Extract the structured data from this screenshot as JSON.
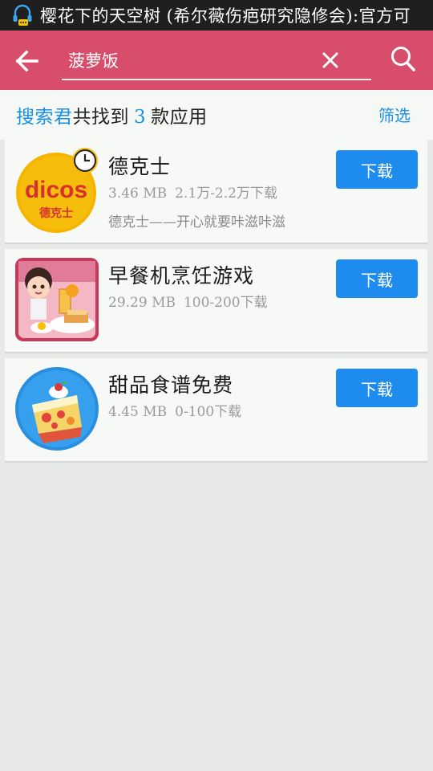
{
  "status_bar": {
    "notification_icon": "headset-icon",
    "notification_text": "樱花下的天空树 (希尔薇伤疤研究隐修会):官方可"
  },
  "app_bar": {
    "back_icon": "arrow-left-icon",
    "search_value": "菠萝饭",
    "clear_icon": "close-icon",
    "search_icon": "search-icon",
    "background_color": "#d94d6c"
  },
  "results_header": {
    "prefix": "搜索君",
    "middle": "共找到",
    "count": "3",
    "suffix": "款应用",
    "filter_label": "筛选",
    "accent_color": "#1a8fe6"
  },
  "apps": [
    {
      "name": "德克士",
      "size": "3.46 MB",
      "downloads": "2.1万-2.2万下载",
      "description": "德克士——开心就要咔滋咔滋",
      "icon": "dicos-logo-icon",
      "icon_brand_text": "dicos",
      "icon_sub_text": "德克士",
      "download_label": "下载"
    },
    {
      "name": "早餐机烹饪游戏",
      "size": "29.29 MB",
      "downloads": "100-200下载",
      "description": "",
      "icon": "breakfast-game-icon",
      "download_label": "下载"
    },
    {
      "name": "甜品食谱免费",
      "size": "4.45 MB",
      "downloads": "0-100下载",
      "description": "",
      "icon": "cake-icon",
      "download_label": "下载"
    }
  ],
  "colors": {
    "download_button": "#1e8cef",
    "page_background": "#e6e9e5"
  }
}
